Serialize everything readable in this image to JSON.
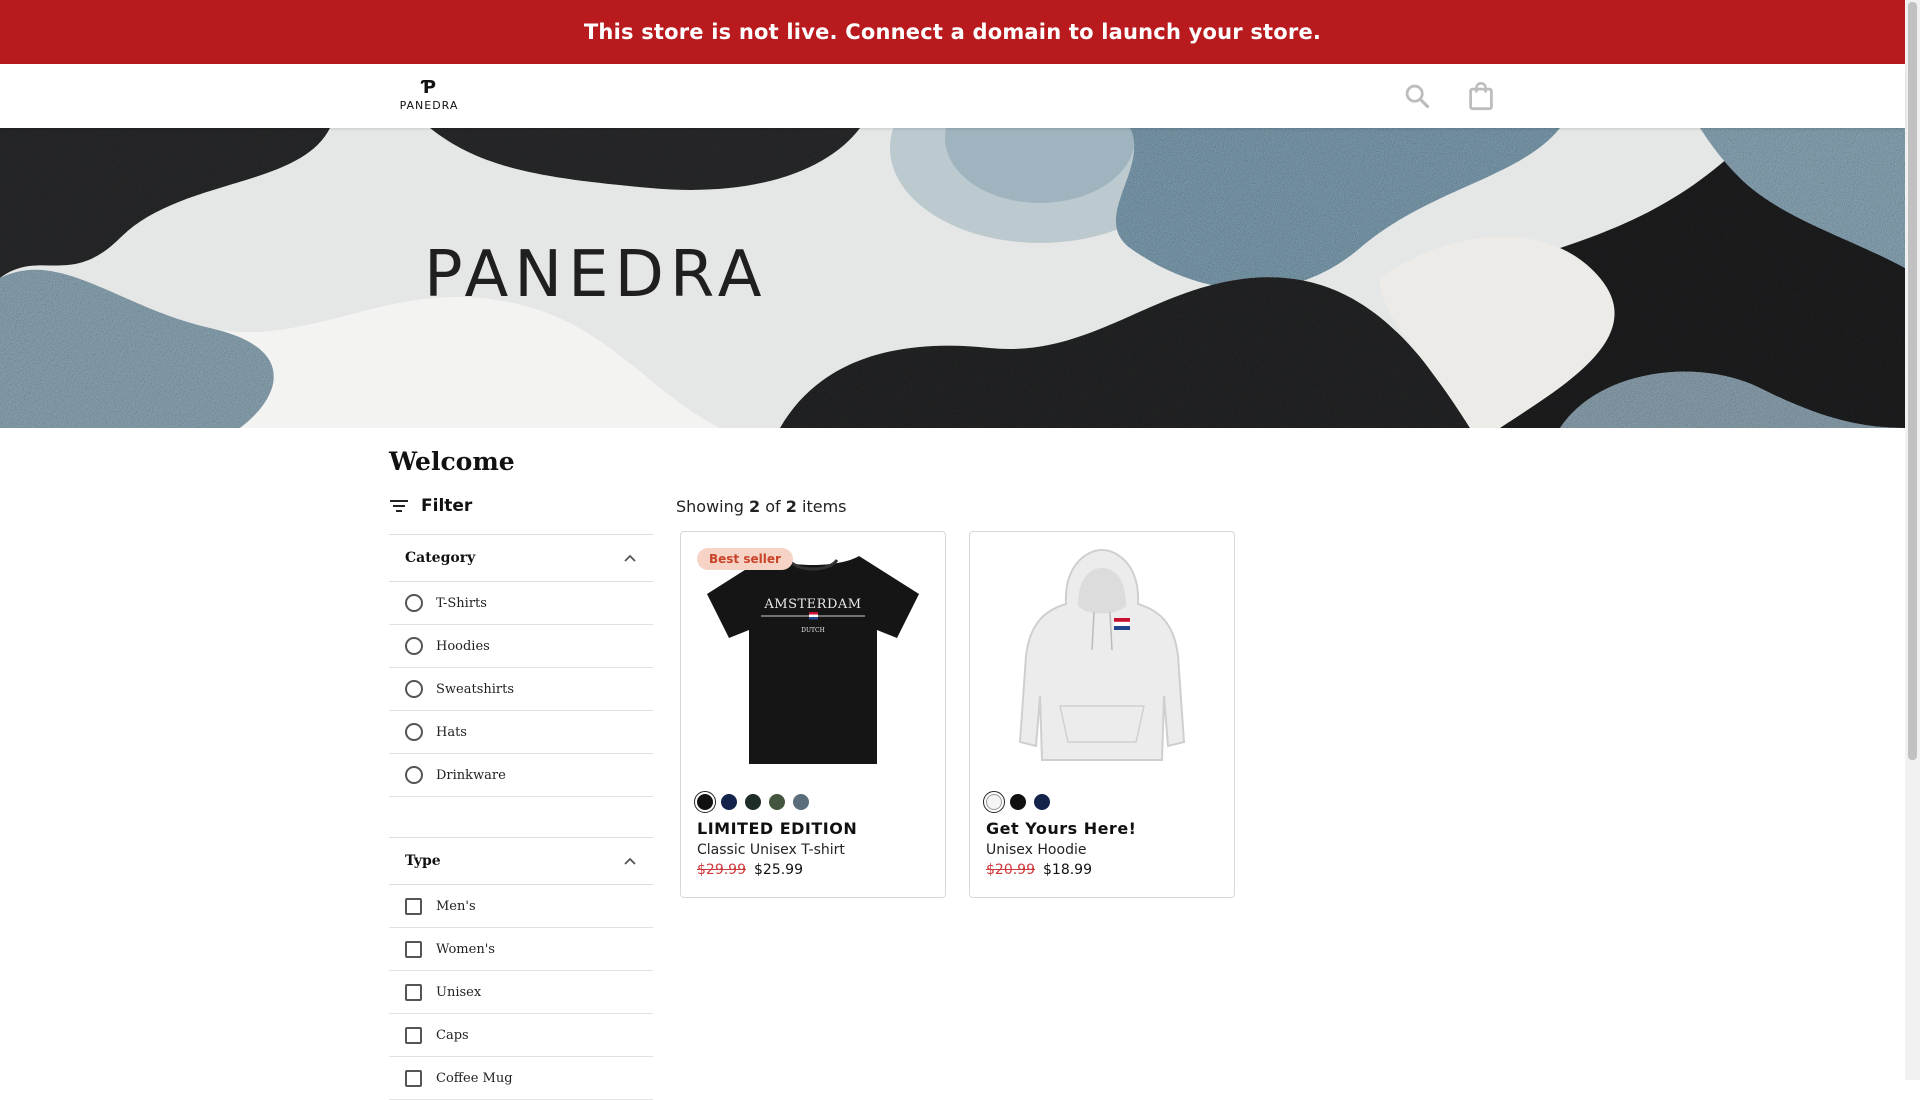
{
  "banner": {
    "text": "This store is not live. Connect a domain to launch your store."
  },
  "header": {
    "logo_mark": "Ƥ",
    "logo_text": "PANEDRA",
    "search_icon": "search-icon",
    "cart_icon": "shopping-bag-icon"
  },
  "hero": {
    "title": "PANEDRA"
  },
  "page": {
    "title": "Welcome"
  },
  "filter": {
    "label": "Filter",
    "category": {
      "title": "Category",
      "options": [
        "T-Shirts",
        "Hoodies",
        "Sweatshirts",
        "Hats",
        "Drinkware"
      ]
    },
    "type": {
      "title": "Type",
      "options": [
        "Men's",
        "Women's",
        "Unisex",
        "Caps",
        "Coffee Mug"
      ]
    }
  },
  "results": {
    "prefix": "Showing",
    "shown": "2",
    "of": "of",
    "total": "2",
    "suffix": "items"
  },
  "products": [
    {
      "badge": "Best seller",
      "title": "LIMITED EDITION",
      "subtitle": "Classic Unisex T-shirt",
      "old_price": "$29.99",
      "price": "$25.99",
      "print_top": "AMSTERDAM",
      "print_bottom": "DUTCH",
      "colors": [
        "#111111",
        "#13234a",
        "#1f2d28",
        "#44553f",
        "#5a6d7a"
      ]
    },
    {
      "title": "Get Yours Here!",
      "subtitle": "Unisex Hoodie",
      "old_price": "$20.99",
      "price": "$18.99",
      "colors": [
        "#f4f4f4",
        "#111111",
        "#13234a"
      ]
    }
  ]
}
